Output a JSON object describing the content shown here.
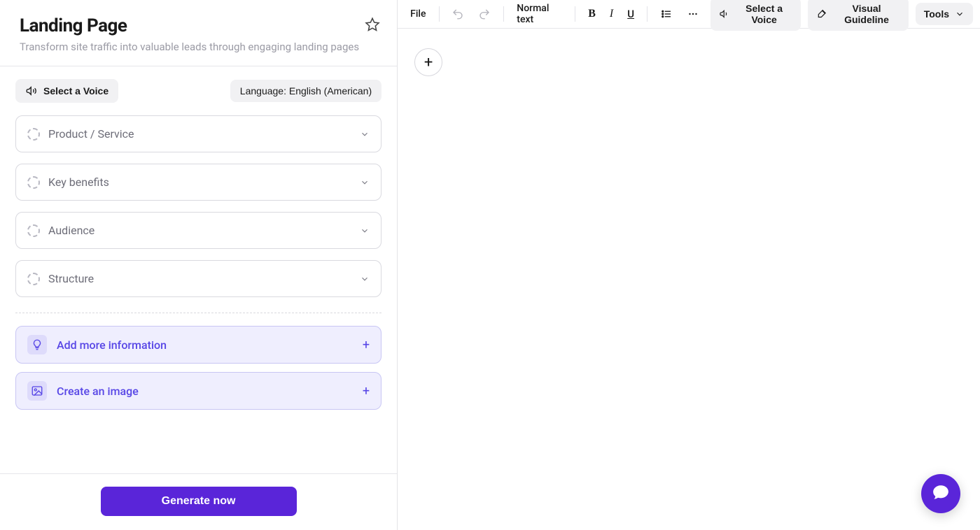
{
  "leftPanel": {
    "title": "Landing Page",
    "subtitle": "Transform site traffic into valuable leads through engaging landing pages",
    "voiceButton": "Select a Voice",
    "languagePill": "Language: English (American)",
    "fields": [
      {
        "label": "Product / Service"
      },
      {
        "label": "Key benefits"
      },
      {
        "label": "Audience"
      },
      {
        "label": "Structure"
      }
    ],
    "addons": {
      "moreInfo": "Add more information",
      "createImage": "Create an image"
    },
    "generate": "Generate now"
  },
  "toolbar": {
    "file": "File",
    "textStyle": "Normal text",
    "voice": "Select a Voice",
    "guideline": "Visual Guideline",
    "tools": "Tools"
  },
  "editor": {
    "addBlockGlyph": "+"
  },
  "icons": {
    "star": "star-icon",
    "megaphone": "megaphone-icon",
    "undo": "undo-icon",
    "redo": "redo-icon",
    "bold": "B",
    "italic": "I",
    "underline": "U",
    "list": "list-icon",
    "more": "more-icon",
    "brush": "brush-icon",
    "chevronDown": "chevron-down-icon",
    "lightbulb": "lightbulb-icon",
    "image": "image-icon",
    "plus": "+",
    "chat": "chat-icon"
  }
}
